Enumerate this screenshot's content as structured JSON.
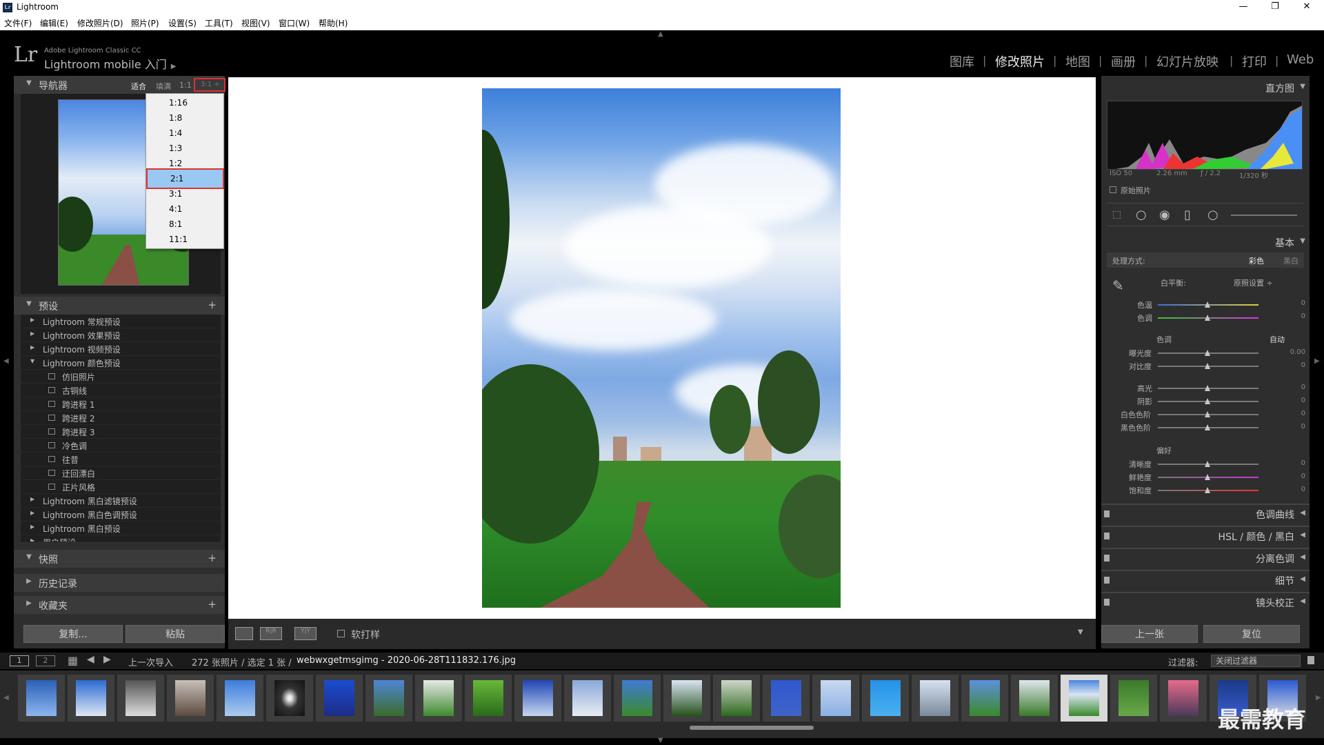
{
  "window": {
    "title": "Lightroom",
    "minimize": "—",
    "restore": "❐",
    "close": "✕"
  },
  "menu": [
    "文件(F)",
    "编辑(E)",
    "修改照片(D)",
    "照片(P)",
    "设置(S)",
    "工具(T)",
    "视图(V)",
    "窗口(W)",
    "帮助(H)"
  ],
  "header": {
    "logo": "Lr",
    "product": "Adobe Lightroom Classic CC",
    "identity": "Lightroom mobile 入门",
    "modules": [
      "图库",
      "修改照片",
      "地图",
      "画册",
      "幻灯片放映",
      "打印",
      "Web"
    ],
    "active_module": "修改照片"
  },
  "navigator": {
    "title": "导航器",
    "zoom_options": [
      "适合",
      "填满",
      "1:1"
    ],
    "zoom_select": "3:1 ÷",
    "dropdown": [
      "1:16",
      "1:8",
      "1:4",
      "1:3",
      "1:2",
      "2:1",
      "3:1",
      "4:1",
      "8:1",
      "11:1"
    ],
    "dropdown_highlight": "2:1"
  },
  "presets": {
    "title": "预设",
    "add": "+",
    "items": [
      {
        "label": "Lightroom 常规预设",
        "child": false
      },
      {
        "label": "Lightroom 效果预设",
        "child": false
      },
      {
        "label": "Lightroom 视频预设",
        "child": false
      },
      {
        "label": "Lightroom 颜色预设",
        "child": false,
        "open": true
      },
      {
        "label": "仿旧照片",
        "child": true
      },
      {
        "label": "古铜线",
        "child": true
      },
      {
        "label": "跨进程 1",
        "child": true
      },
      {
        "label": "跨进程 2",
        "child": true
      },
      {
        "label": "跨进程 3",
        "child": true
      },
      {
        "label": "冷色调",
        "child": true
      },
      {
        "label": "往昔",
        "child": true
      },
      {
        "label": "迂回漂白",
        "child": true
      },
      {
        "label": "正片风格",
        "child": true
      },
      {
        "label": "Lightroom 黑白滤镜预设",
        "child": false
      },
      {
        "label": "Lightroom 黑白色调预设",
        "child": false
      },
      {
        "label": "Lightroom 黑白预设",
        "child": false
      },
      {
        "label": "用户预设",
        "child": false
      }
    ]
  },
  "snapshots": {
    "title": "快照",
    "add": "+"
  },
  "history": {
    "title": "历史记录"
  },
  "collections": {
    "title": "收藏夹",
    "add": "+"
  },
  "left_buttons": {
    "copy": "复制...",
    "paste": "粘贴"
  },
  "center_toolbar": {
    "softproof": "软打样",
    "view_btn_1": "▭",
    "view_btn_2": "R|R",
    "view_btn_3": "Y|Y",
    "menu_arrow": "▼"
  },
  "right": {
    "histogram_title": "直方图",
    "meta": {
      "iso": "ISO 50",
      "focal": "2.26 mm",
      "aperture": "ƒ / 2.2",
      "shutter": "1/320 秒"
    },
    "original_photo": "原始照片",
    "basic_title": "基本",
    "treatment_label": "处理方式:",
    "treatment_color": "彩色",
    "treatment_bw": "黑白",
    "wb_label": "白平衡:",
    "wb_value": "原照设置 ÷",
    "wb_sliders": [
      {
        "label": "色温",
        "value": "0"
      },
      {
        "label": "色调",
        "value": "0"
      }
    ],
    "tone_title": "色调",
    "tone_auto": "自动",
    "tone_sliders": [
      {
        "label": "曝光度",
        "value": "0.00"
      },
      {
        "label": "对比度",
        "value": "0"
      }
    ],
    "tone_sliders2": [
      {
        "label": "高光",
        "value": "0"
      },
      {
        "label": "阴影",
        "value": "0"
      },
      {
        "label": "白色色阶",
        "value": "0"
      },
      {
        "label": "黑色色阶",
        "value": "0"
      }
    ],
    "presence_title": "偏好",
    "presence_sliders": [
      {
        "label": "清晰度",
        "value": "0"
      },
      {
        "label": "鲜艳度",
        "value": "0"
      },
      {
        "label": "饱和度",
        "value": "0"
      }
    ],
    "collapsed_panels": [
      "色调曲线",
      "HSL  /  颜色  /  黑白",
      "分离色调",
      "细节",
      "镜头校正"
    ],
    "prev_button": "上一张",
    "reset_button": "复位"
  },
  "filmstrip_bar": {
    "view1": "1",
    "view2": "2",
    "source": "上一次导入",
    "count": "272 张照片 / 选定 1 张 /",
    "filename": "webwxgetmsgimg - 2020-06-28T111832.176.jpg",
    "filter_label": "过滤器:",
    "filter_value": "关闭过滤器"
  },
  "watermark": "最需教育"
}
